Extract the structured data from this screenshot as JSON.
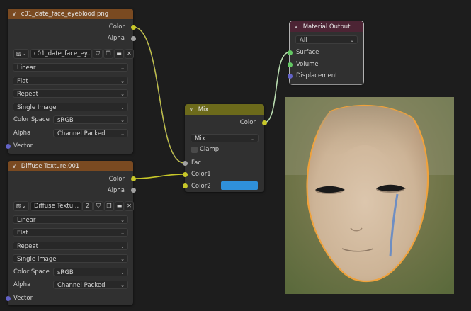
{
  "image_node_1": {
    "title": "c01_date_face_eyeblood.png",
    "outputs": {
      "color": "Color",
      "alpha": "Alpha"
    },
    "image_name": "c01_date_face_ey...",
    "interpolation": "Linear",
    "projection": "Flat",
    "extension": "Repeat",
    "source": "Single Image",
    "color_space_label": "Color Space",
    "color_space": "sRGB",
    "alpha_label": "Alpha",
    "alpha_mode": "Channel Packed",
    "vector_label": "Vector"
  },
  "image_node_2": {
    "title": "Diffuse Texture.001",
    "outputs": {
      "color": "Color",
      "alpha": "Alpha"
    },
    "image_name": "Diffuse Textu...",
    "user_count": "2",
    "interpolation": "Linear",
    "projection": "Flat",
    "extension": "Repeat",
    "source": "Single Image",
    "color_space_label": "Color Space",
    "color_space": "sRGB",
    "alpha_label": "Alpha",
    "alpha_mode": "Channel Packed",
    "vector_label": "Vector"
  },
  "mix_node": {
    "title": "Mix",
    "output": "Color",
    "blend_type": "Mix",
    "clamp_label": "Clamp",
    "inputs": {
      "fac": "Fac",
      "color1": "Color1",
      "color2": "Color2"
    },
    "color2_value": "#2f90da"
  },
  "output_node": {
    "title": "Material Output",
    "target": "All",
    "inputs": {
      "surface": "Surface",
      "volume": "Volume",
      "displacement": "Displacement"
    }
  },
  "colors": {
    "texture_header": "#7a4a21",
    "mix_header": "#6c6a1b",
    "output_header": "#4c2434",
    "socket_color": "#c7c729",
    "socket_float": "#a1a1a1",
    "socket_vector": "#6363c7",
    "socket_shader": "#63c763",
    "link_color": "#c7c729"
  }
}
